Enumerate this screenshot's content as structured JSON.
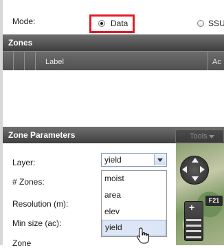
{
  "mode": {
    "label": "Mode:",
    "options": [
      {
        "label": "Data",
        "checked": true
      },
      {
        "label": "SSU",
        "checked": false
      }
    ],
    "highlight_color": "#e31b23"
  },
  "zones_panel": {
    "title": "Zones",
    "columns": [
      "",
      "",
      "Label",
      "Ac"
    ]
  },
  "zone_parameters": {
    "title": "Zone Parameters",
    "tools_label": "Tools",
    "fields": [
      {
        "label": "Layer:"
      },
      {
        "label": "# Zones:"
      },
      {
        "label": "Resolution (m):"
      },
      {
        "label": "Min size (ac):"
      },
      {
        "label": "Zone"
      }
    ],
    "layer_select": {
      "value": "yield",
      "options": [
        "moist",
        "area",
        "elev",
        "yield"
      ],
      "highlighted": "yield"
    }
  },
  "map": {
    "badge": "F21"
  }
}
